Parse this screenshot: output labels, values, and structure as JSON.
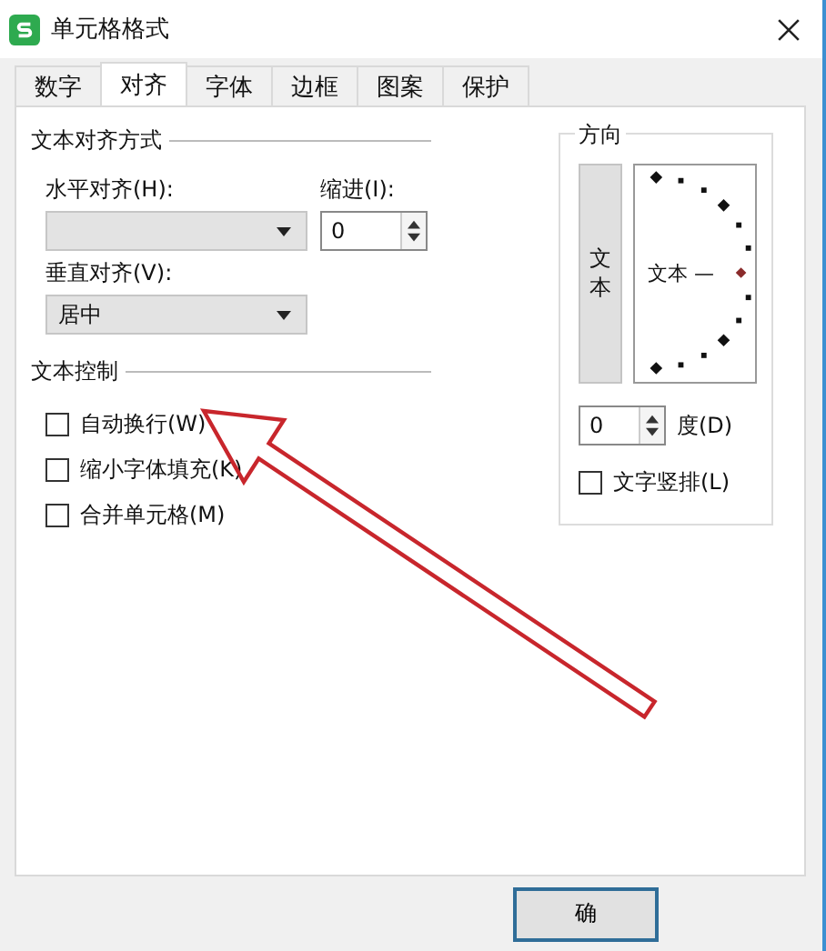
{
  "window": {
    "title": "单元格格式"
  },
  "tabs": [
    {
      "label": "数字",
      "selected": false
    },
    {
      "label": "对齐",
      "selected": true
    },
    {
      "label": "字体",
      "selected": false
    },
    {
      "label": "边框",
      "selected": false
    },
    {
      "label": "图案",
      "selected": false
    },
    {
      "label": "保护",
      "selected": false
    }
  ],
  "text_alignment": {
    "title": "文本对齐方式",
    "horizontal_label": "水平对齐(H):",
    "indent_label": "缩进(I):",
    "indent_value": "0",
    "vertical_label": "垂直对齐(V):",
    "vertical_value": "居中"
  },
  "text_control": {
    "title": "文本控制",
    "options": [
      {
        "label": "自动换行(W)",
        "checked": false
      },
      {
        "label": "缩小字体填充(K)",
        "checked": false
      },
      {
        "label": "合并单元格(M)",
        "checked": false
      }
    ]
  },
  "orientation": {
    "title": "方向",
    "vertical_text": "文本",
    "dial_label": "文本 —",
    "degree_value": "0",
    "degree_label": "度(D)",
    "stacked": {
      "label": "文字竖排(L)",
      "checked": false
    }
  },
  "footer": {
    "buttons": [
      "确"
    ]
  }
}
